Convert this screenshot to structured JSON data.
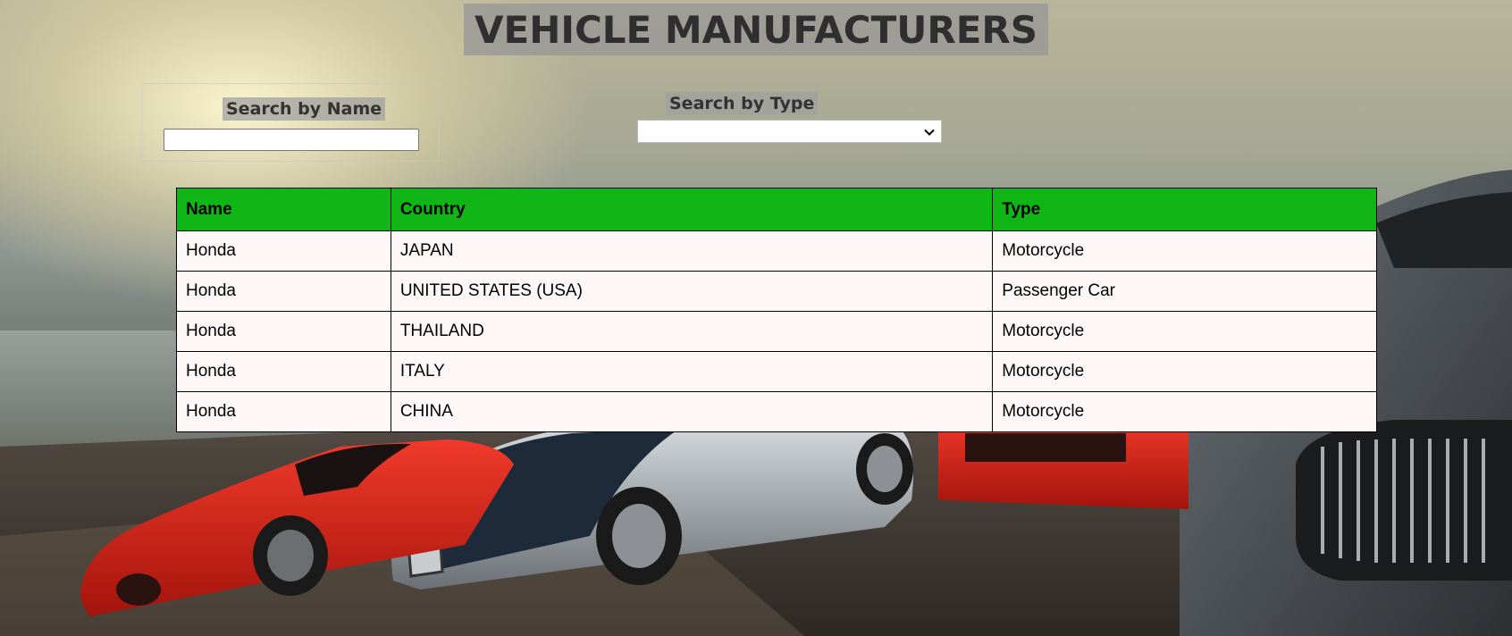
{
  "page": {
    "title": "VEHICLE MANUFACTURERS"
  },
  "search_by_name": {
    "label": "Search by Name",
    "value": "",
    "placeholder": ""
  },
  "search_by_type": {
    "label": "Search by Type",
    "selected": "",
    "icon": "chevron-down-icon"
  },
  "table": {
    "headers": [
      "Name",
      "Country",
      "Type"
    ],
    "rows": [
      [
        "Honda",
        "JAPAN",
        "Motorcycle"
      ],
      [
        "Honda",
        "UNITED STATES (USA)",
        "Passenger Car"
      ],
      [
        "Honda",
        "THAILAND",
        "Motorcycle"
      ],
      [
        "Honda",
        "ITALY",
        "Motorcycle"
      ],
      [
        "Honda",
        "CHINA",
        "Motorcycle"
      ]
    ]
  },
  "colors": {
    "table_header": "#10b516",
    "table_row": "#fdf7f7",
    "title_text": "#2f2f2f"
  }
}
